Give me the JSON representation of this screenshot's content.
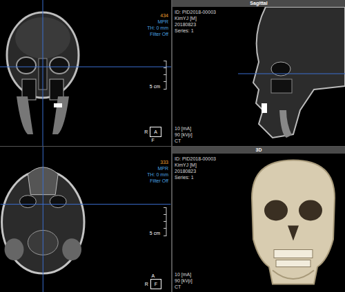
{
  "views": [
    {
      "header": "Sagittal",
      "kind": "coronal",
      "preview": "sagittal",
      "slice": "434",
      "mode": "MPR",
      "thickness": "TH: 0 mm",
      "filter": "Filter Off",
      "scale": "5 cm",
      "orientation": {
        "left": "R",
        "box": "A",
        "below": "F"
      },
      "patient": [
        "ID: PID2018-00003",
        "KimYJ [M]",
        "20180823",
        "Series: 1"
      ],
      "acquisition": [
        "10 [mA]",
        "90 [kVp]",
        "CT"
      ]
    },
    {
      "header": "3D",
      "kind": "axial",
      "preview": "3d",
      "slice": "333",
      "mode": "MPR",
      "thickness": "TH: 0 mm",
      "filter": "Filter Off",
      "scale": "5 cm",
      "orientation": {
        "above": "A",
        "left": "R",
        "box": "F"
      },
      "patient": [
        "ID: PID2018-00003",
        "KimYJ [M]",
        "20180823",
        "Series: 1"
      ],
      "acquisition": [
        "10 [mA]",
        "90 [kVp]",
        "CT"
      ]
    }
  ]
}
